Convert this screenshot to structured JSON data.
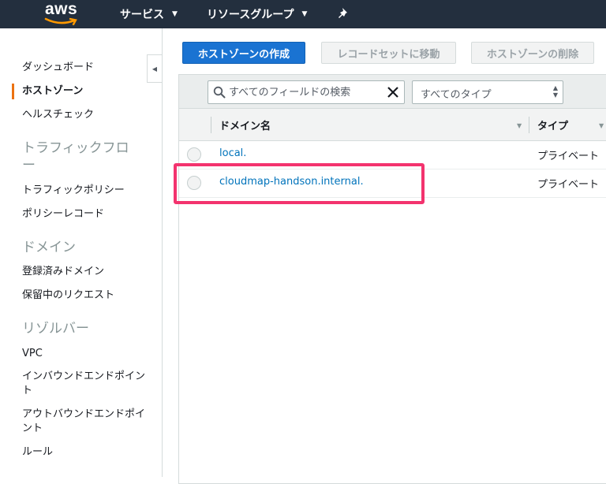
{
  "header": {
    "logo_text": "aws",
    "services_label": "サービス",
    "resource_groups_label": "リソースグループ",
    "pin_icon": "pin-icon"
  },
  "sidebar": {
    "items": {
      "dashboard": "ダッシュボード",
      "hosted_zones": "ホストゾーン",
      "health_checks": "ヘルスチェック",
      "traffic_policies": "トラフィックポリシー",
      "policy_records": "ポリシーレコード",
      "registered_domains": "登録済みドメイン",
      "pending_requests": "保留中のリクエスト",
      "vpc": "VPC",
      "inbound_endpoints": "インバウンドエンドポイント",
      "outbound_endpoints": "アウトバウンドエンドポイント",
      "rules": "ルール"
    },
    "sections": {
      "traffic_flow": "トラフィックフロー",
      "domains": "ドメイン",
      "resolver": "リゾルバー"
    },
    "active_item": "ホストゾーン"
  },
  "toolbar": {
    "create_label": "ホストゾーンの作成",
    "goto_records_label": "レコードセットに移動",
    "delete_label": "ホストゾーンの削除"
  },
  "filter": {
    "search_placeholder": "すべてのフィールドの検索",
    "type_select_value": "すべてのタイプ"
  },
  "table": {
    "columns": {
      "domain": "ドメイン名",
      "type": "タイプ"
    },
    "rows": [
      {
        "domain": "local.",
        "type": "プライベート"
      },
      {
        "domain": "cloudmap-handson.internal.",
        "type": "プライベート"
      }
    ]
  },
  "colors": {
    "topbar": "#232f3e",
    "primary_button": "#1a73d2",
    "active_indicator": "#ec7211",
    "link": "#0073bb",
    "highlight_box": "#f3336e"
  }
}
